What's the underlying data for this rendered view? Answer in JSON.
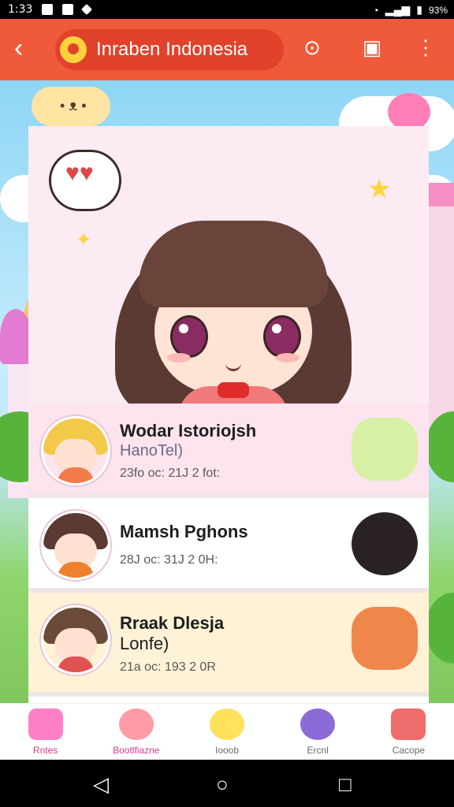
{
  "status_bar": {
    "time": "1:33",
    "battery": "93%"
  },
  "app_bar": {
    "title": "Inraben Indonesia"
  },
  "list": [
    {
      "name": "Wodar Istoriojsh",
      "subtitle": "HanoTel)",
      "meta": "23fo oc: 21J 2 fot:"
    },
    {
      "name": "Mamsh Pghons",
      "subtitle": "",
      "meta": "28J oc: 31J 2 0H:"
    },
    {
      "name": "Rraak Dlesja",
      "subtitle": "Lonfe)",
      "meta": "21a oc: 193 2 0R"
    }
  ],
  "bottom_nav": [
    {
      "label": "Rntes",
      "active": true
    },
    {
      "label": "Bootlfiazne",
      "active": false
    },
    {
      "label": "Iooob",
      "active": false
    },
    {
      "label": "Ercnl",
      "active": false
    },
    {
      "label": "Cacope",
      "active": false
    }
  ],
  "colors": {
    "app_bar": "#ef5a3a",
    "accent": "#d23b8f"
  }
}
